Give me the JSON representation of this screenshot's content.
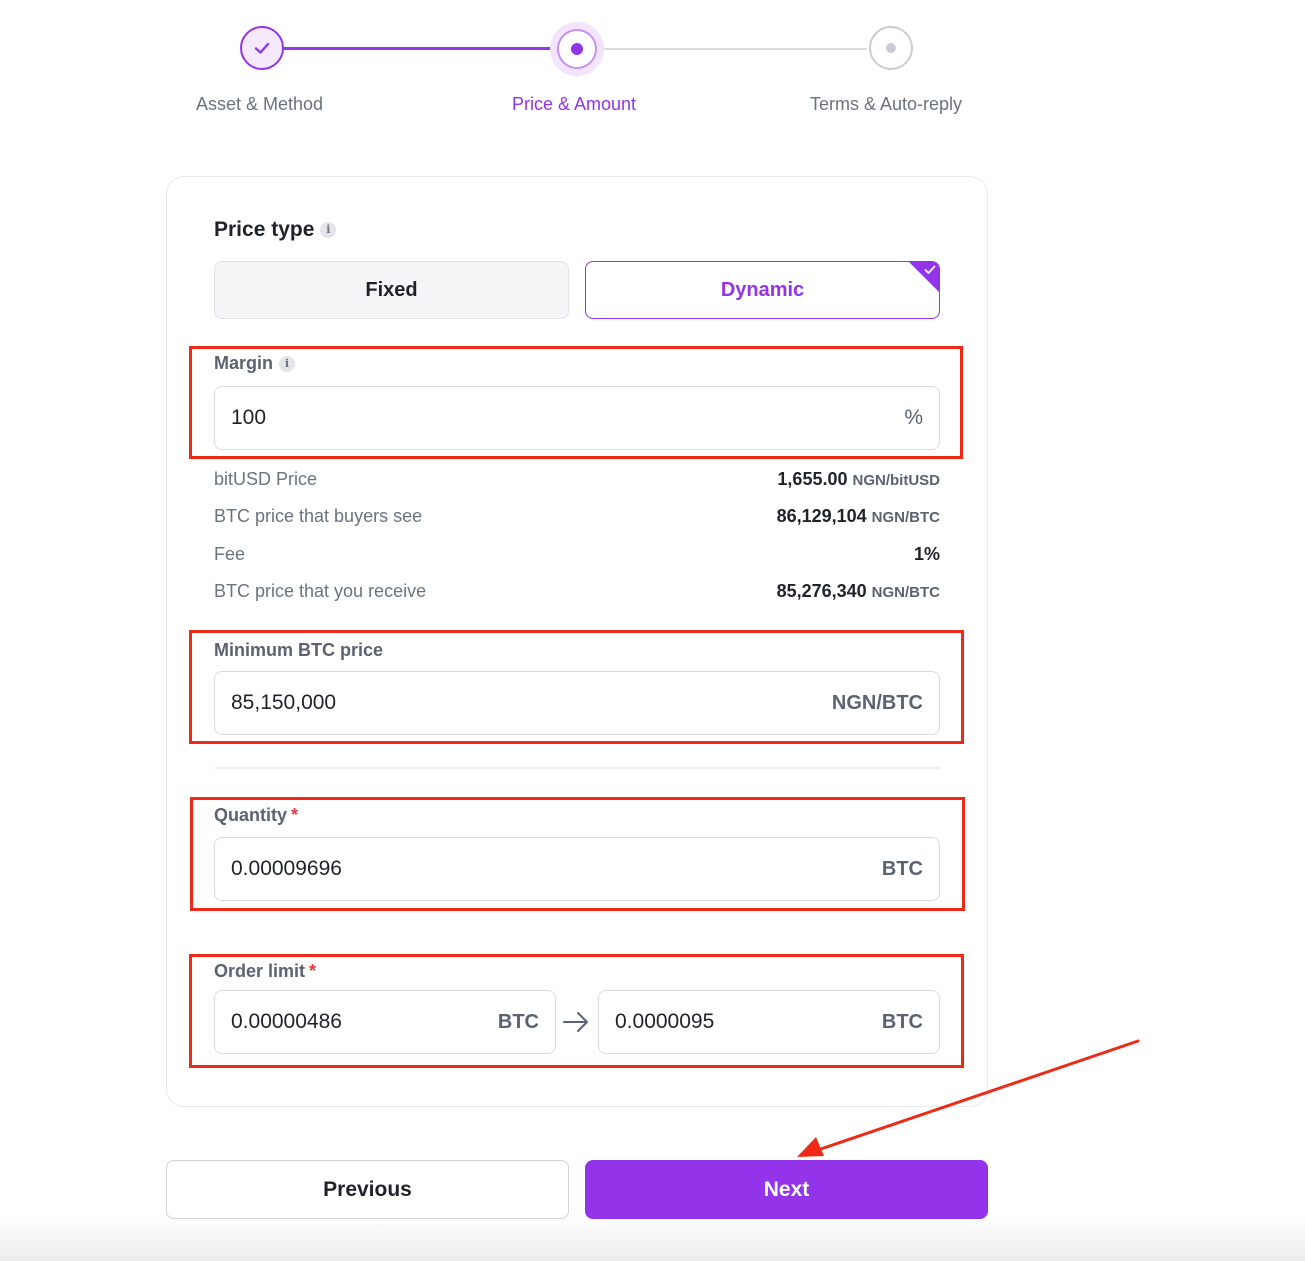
{
  "stepper": {
    "steps": [
      {
        "label": "Asset & Method",
        "state": "done"
      },
      {
        "label": "Price & Amount",
        "state": "active"
      },
      {
        "label": "Terms & Auto-reply",
        "state": "pending"
      }
    ]
  },
  "price_type": {
    "title": "Price type",
    "options": [
      {
        "label": "Fixed",
        "selected": false
      },
      {
        "label": "Dynamic",
        "selected": true
      }
    ]
  },
  "margin": {
    "label": "Margin",
    "value": "100",
    "unit": "%"
  },
  "price_info": [
    {
      "label": "bitUSD Price",
      "value": "1,655.00",
      "unit": "NGN/bitUSD"
    },
    {
      "label": "BTC price that buyers see",
      "value": "86,129,104",
      "unit": "NGN/BTC"
    },
    {
      "label": "Fee",
      "value": "1%",
      "unit": ""
    },
    {
      "label": "BTC price that you receive",
      "value": "85,276,340",
      "unit": "NGN/BTC"
    }
  ],
  "min_price": {
    "label": "Minimum BTC price",
    "value": "85,150,000",
    "unit": "NGN/BTC"
  },
  "quantity": {
    "label": "Quantity",
    "required_mark": "*",
    "value": "0.00009696",
    "unit": "BTC"
  },
  "order_limit": {
    "label": "Order limit",
    "required_mark": "*",
    "min_value": "0.00000486",
    "max_value": "0.0000095",
    "unit": "BTC"
  },
  "buttons": {
    "previous": "Previous",
    "next": "Next"
  },
  "colors": {
    "accent": "#9333ea",
    "annotation": "#ee2a16"
  }
}
